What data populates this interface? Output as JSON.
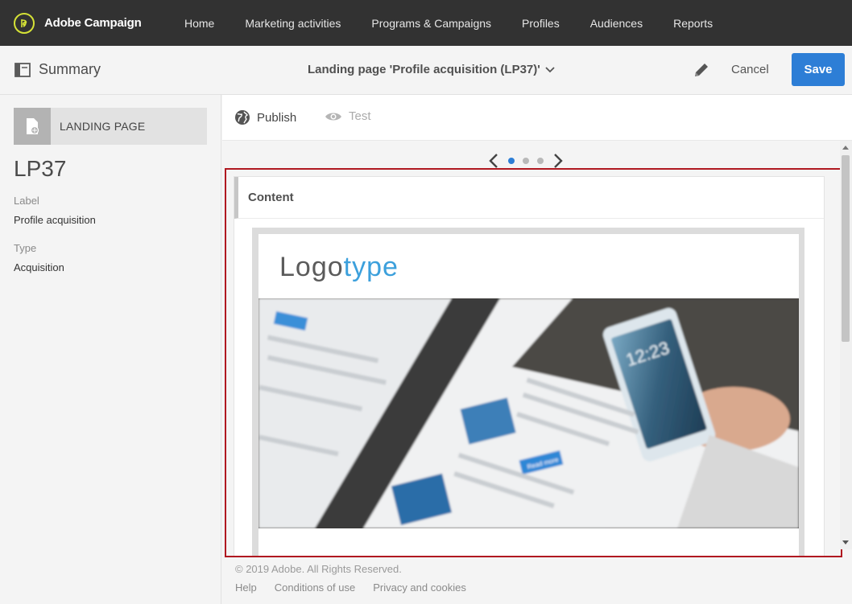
{
  "app": {
    "name": "Adobe Campaign",
    "logo_icon": "adobe-campaign-logo-icon",
    "accent_color": "#d5e236"
  },
  "nav": {
    "items": [
      {
        "label": "Home"
      },
      {
        "label": "Marketing activities"
      },
      {
        "label": "Programs & Campaigns"
      },
      {
        "label": "Profiles"
      },
      {
        "label": "Audiences"
      },
      {
        "label": "Reports"
      }
    ]
  },
  "summary_bar": {
    "summary_label": "Summary",
    "page_title": "Landing page 'Profile acquisition (LP37)'",
    "cancel_label": "Cancel",
    "save_label": "Save",
    "save_color": "#2d7ed6"
  },
  "left_panel": {
    "badge_label": "LANDING PAGE",
    "id": "LP37",
    "fields": [
      {
        "label": "Label",
        "value": "Profile acquisition"
      },
      {
        "label": "Type",
        "value": "Acquisition"
      }
    ]
  },
  "toolbar": {
    "publish_label": "Publish",
    "test_label": "Test"
  },
  "pager": {
    "pages": 3,
    "active": 1
  },
  "content": {
    "title": "Content",
    "logo_part1": "Logo",
    "logo_part2": "type",
    "phone_time": "12:23",
    "read_more": "Read more"
  },
  "footer": {
    "copyright": "© 2019 Adobe. All Rights Reserved.",
    "links": [
      {
        "label": "Help"
      },
      {
        "label": "Conditions of use"
      },
      {
        "label": "Privacy and cookies"
      }
    ]
  }
}
